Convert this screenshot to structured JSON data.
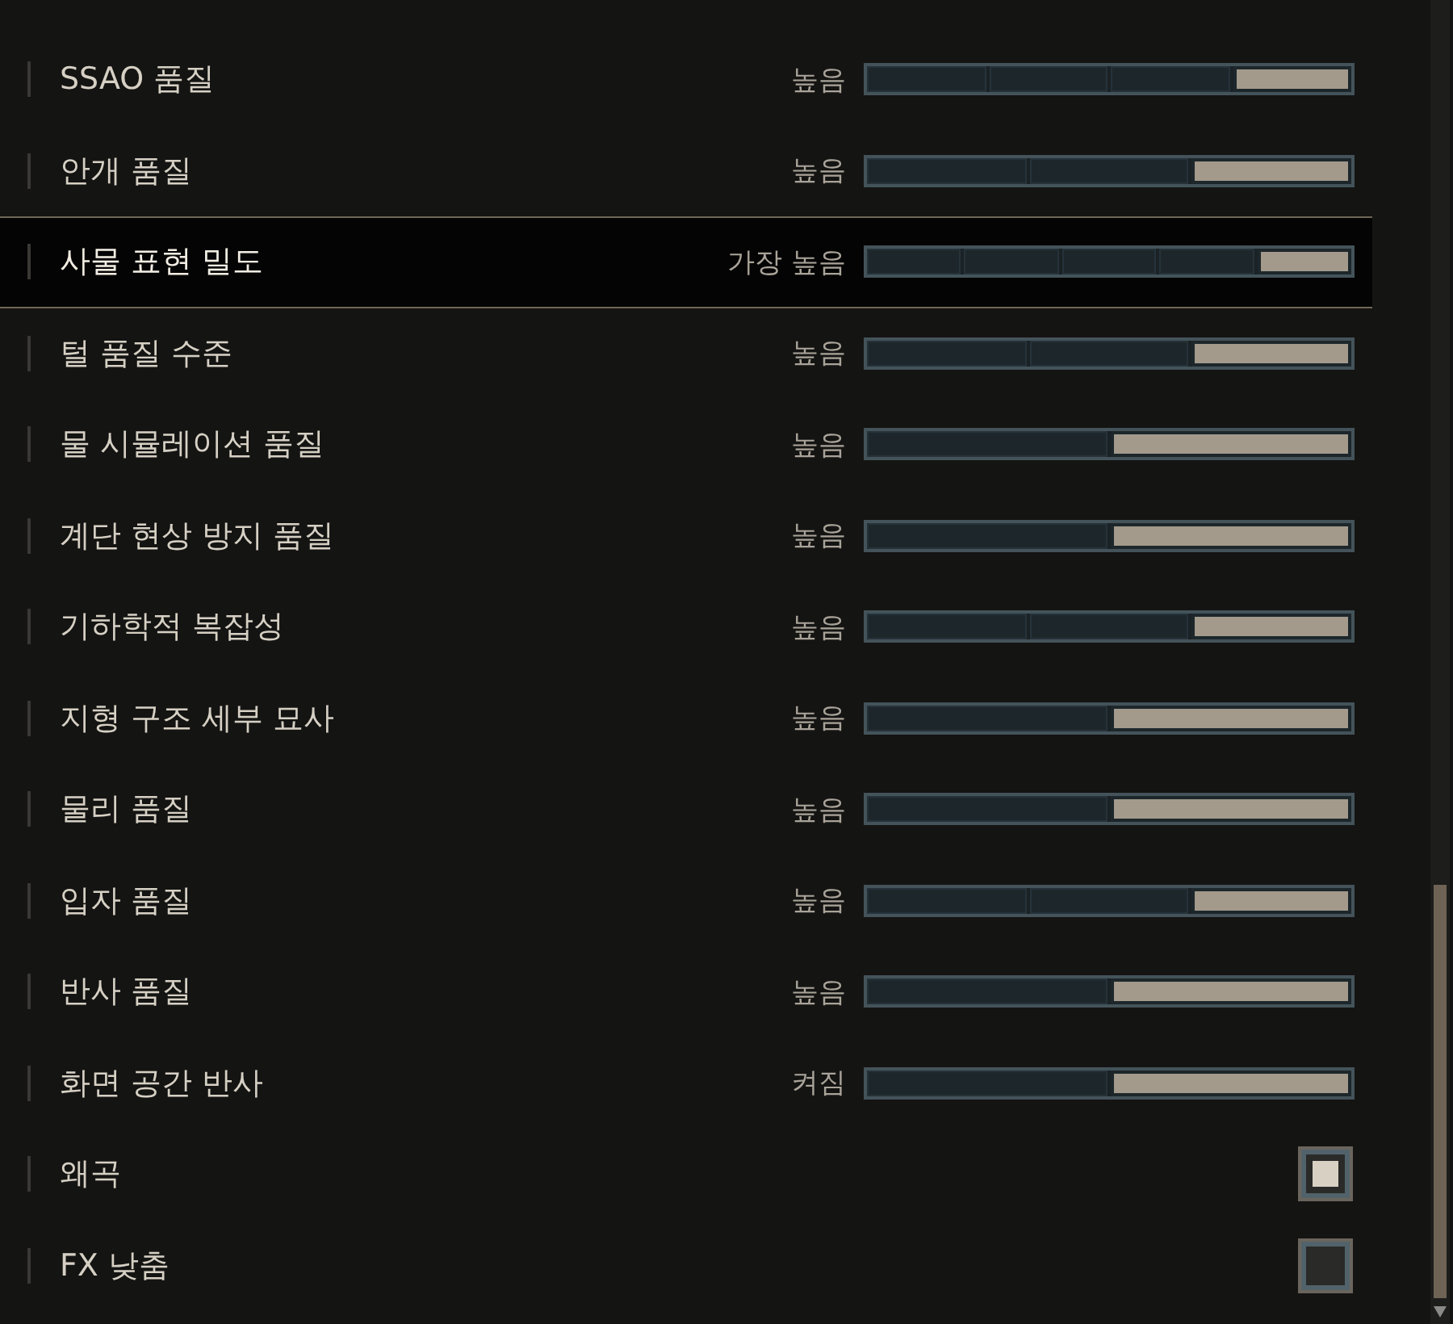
{
  "settings": [
    {
      "kind": "slider",
      "label": "SSAO 품질",
      "value": "높음",
      "selected": false,
      "segments": [
        {
          "selected": false
        },
        {
          "selected": false
        },
        {
          "selected": false
        },
        {
          "selected": true
        }
      ]
    },
    {
      "kind": "slider",
      "label": "안개 품질",
      "value": "높음",
      "selected": false,
      "segments": [
        {
          "selected": false
        },
        {
          "selected": false
        },
        {
          "selected": true
        }
      ]
    },
    {
      "kind": "slider",
      "label": "사물 표현 밀도",
      "value": "가장 높음",
      "selected": true,
      "segments": [
        {
          "selected": false
        },
        {
          "selected": false
        },
        {
          "selected": false
        },
        {
          "selected": false
        },
        {
          "selected": true
        }
      ]
    },
    {
      "kind": "slider",
      "label": "털 품질 수준",
      "value": "높음",
      "selected": false,
      "segments": [
        {
          "selected": false
        },
        {
          "selected": false
        },
        {
          "selected": true
        }
      ]
    },
    {
      "kind": "slider",
      "label": "물 시뮬레이션 품질",
      "value": "높음",
      "selected": false,
      "segments": [
        {
          "selected": false
        },
        {
          "selected": true
        }
      ]
    },
    {
      "kind": "slider",
      "label": "계단 현상 방지 품질",
      "value": "높음",
      "selected": false,
      "segments": [
        {
          "selected": false
        },
        {
          "selected": true
        }
      ]
    },
    {
      "kind": "slider",
      "label": "기하학적 복잡성",
      "value": "높음",
      "selected": false,
      "segments": [
        {
          "selected": false
        },
        {
          "selected": false
        },
        {
          "selected": true
        }
      ]
    },
    {
      "kind": "slider",
      "label": "지형 구조 세부 묘사",
      "value": "높음",
      "selected": false,
      "segments": [
        {
          "selected": false
        },
        {
          "selected": true
        }
      ]
    },
    {
      "kind": "slider",
      "label": "물리 품질",
      "value": "높음",
      "selected": false,
      "segments": [
        {
          "selected": false
        },
        {
          "selected": true
        }
      ]
    },
    {
      "kind": "slider",
      "label": "입자 품질",
      "value": "높음",
      "selected": false,
      "segments": [
        {
          "selected": false
        },
        {
          "selected": false
        },
        {
          "selected": true
        }
      ]
    },
    {
      "kind": "slider",
      "label": "반사 품질",
      "value": "높음",
      "selected": false,
      "segments": [
        {
          "selected": false
        },
        {
          "selected": true
        }
      ]
    },
    {
      "kind": "slider",
      "label": "화면 공간 반사",
      "value": "켜짐",
      "selected": false,
      "segments": [
        {
          "selected": false
        },
        {
          "selected": true
        }
      ]
    },
    {
      "kind": "checkbox",
      "label": "왜곡",
      "selected": false,
      "checked": true
    },
    {
      "kind": "checkbox",
      "label": "FX 낮춤",
      "selected": false,
      "checked": false
    }
  ]
}
